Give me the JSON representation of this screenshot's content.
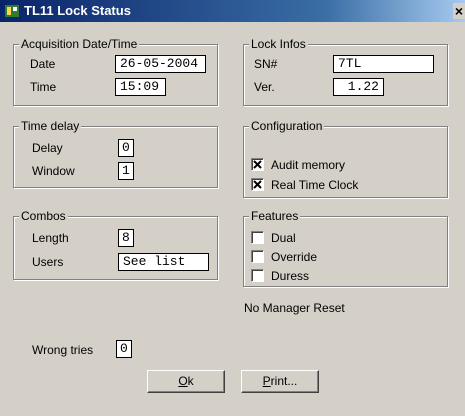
{
  "window": {
    "title": "TL11 Lock Status",
    "close_glyph": "×"
  },
  "acquisition": {
    "legend": "Acquisition Date/Time",
    "date_label": "Date",
    "date_value": "26-05-2004",
    "time_label": "Time",
    "time_value": "15:09"
  },
  "lock_infos": {
    "legend": "Lock Infos",
    "sn_label": "SN#",
    "sn_value": "7TL",
    "ver_label": "Ver.",
    "ver_value": "1.22"
  },
  "time_delay": {
    "legend": "Time delay",
    "delay_label": "Delay",
    "delay_value": "0",
    "window_label": "Window",
    "window_value": "1"
  },
  "configuration": {
    "legend": "Configuration",
    "items": [
      {
        "label": "Audit memory",
        "checked": true
      },
      {
        "label": "Real Time Clock",
        "checked": true
      }
    ]
  },
  "combos": {
    "legend": "Combos",
    "length_label": "Length",
    "length_value": "8",
    "users_label": "Users",
    "users_value": "See list"
  },
  "features": {
    "legend": "Features",
    "items": [
      {
        "label": "Dual",
        "checked": false
      },
      {
        "label": "Override",
        "checked": false
      },
      {
        "label": "Duress",
        "checked": false
      }
    ]
  },
  "status": {
    "manager_reset": "No Manager Reset"
  },
  "wrong_tries": {
    "label": "Wrong tries",
    "value": "0"
  },
  "buttons": {
    "ok_mnemonic": "O",
    "ok_rest": "k",
    "print_mnemonic": "P",
    "print_rest": "rint..."
  },
  "colors": {
    "dialog_bg": "#d4d0c8",
    "title_start": "#0a246a",
    "title_end": "#a6caf0"
  }
}
